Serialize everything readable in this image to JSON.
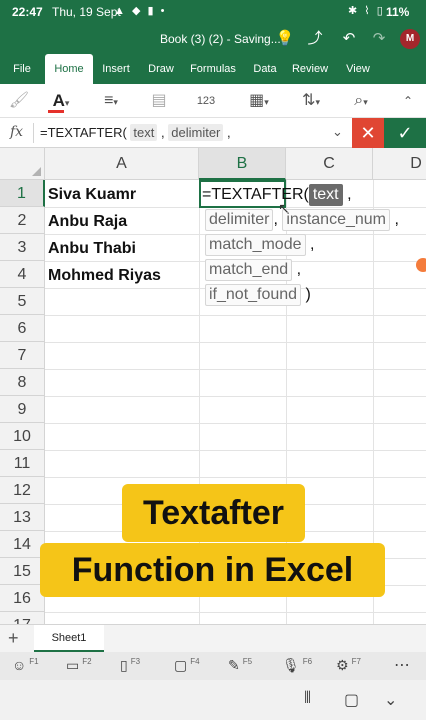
{
  "status": {
    "time": "22:47",
    "date": "Thu, 19 Sept",
    "left_icons": "▲ ◆ ▮ •",
    "right_icons": "✱ ⌇ ▯",
    "battery": "11%"
  },
  "titlebar": {
    "doc_title": "Book (3) (2) - Saving...",
    "avatar_initial": "M"
  },
  "tabs": [
    {
      "label": "File"
    },
    {
      "label": "Home"
    },
    {
      "label": "Insert"
    },
    {
      "label": "Draw"
    },
    {
      "label": "Formulas"
    },
    {
      "label": "Data"
    },
    {
      "label": "Review"
    },
    {
      "label": "View"
    }
  ],
  "formula_bar": {
    "fx_label": "fx",
    "prefix": "=TEXTAFTER(",
    "arg1": "text",
    "sep1": ",",
    "arg2": "delimiter",
    "sep2": ","
  },
  "grid": {
    "columns": [
      "A",
      "B",
      "C",
      "D"
    ],
    "selected_column": "B",
    "rows": [
      "1",
      "2",
      "3",
      "4",
      "5",
      "6",
      "7",
      "8",
      "9",
      "10",
      "11",
      "12",
      "13",
      "14",
      "15",
      "16",
      "17"
    ],
    "selected_row": "1",
    "cells_a": [
      "Siva Kuamr",
      "Anbu Raja",
      "Anbu Thabi",
      "Mohmed Riyas"
    ]
  },
  "formula_tooltip": {
    "func": "=TEXTAFTER(",
    "arg_text": "text",
    "comma": ",",
    "arg_delimiter": "delimiter",
    "arg_instance": "instance_num",
    "arg_match_mode": "match_mode",
    "arg_match_end": "match_end",
    "arg_if_not_found": "if_not_found",
    "close": ")"
  },
  "banner": {
    "line1": "Textafter",
    "line2": "Function in Excel"
  },
  "sheets": [
    {
      "label": "Sheet1"
    }
  ],
  "keyboard_bar": {
    "f1": "F1",
    "f2": "F2",
    "f3": "F3",
    "f4": "F4",
    "f5": "F5",
    "f6": "F6",
    "f7": "F7"
  },
  "colors": {
    "excel_green": "#1e7145",
    "cancel_red": "#e04633",
    "banner_yellow": "#f5c518"
  }
}
